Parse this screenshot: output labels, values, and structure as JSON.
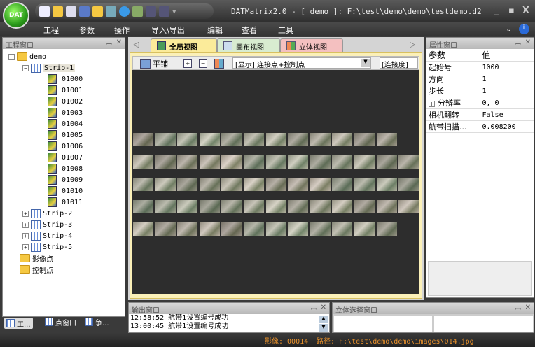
{
  "app": {
    "logo": "DAT",
    "title": "DATMatrix2.0 - [ demo ]: F:\\test\\demo\\demo\\testdemo.d2"
  },
  "menu": [
    "工程",
    "参数",
    "操作",
    "导入\\导出",
    "编辑",
    "查看",
    "工具"
  ],
  "project_panel": {
    "title": "工程窗口",
    "root": "demo",
    "strip1": "Strip-1",
    "images": [
      "01000",
      "01001",
      "01002",
      "01003",
      "01004",
      "01005",
      "01006",
      "01007",
      "01008",
      "01009",
      "01010",
      "01011"
    ],
    "strips": [
      "Strip-2",
      "Strip-3",
      "Strip-4",
      "Strip-5"
    ],
    "image_points": "影像点",
    "control_points": "控制点"
  },
  "bottom_tabs": [
    "工...",
    "点窗口",
    "争..."
  ],
  "tabs": [
    "全局视图",
    "画布视图",
    "立体视图"
  ],
  "toolbar": {
    "tile": "平铺",
    "display": "[显示] 连接点+控制点",
    "connectivity": "[连接度]"
  },
  "image_rows": [
    12,
    13,
    13,
    13,
    12
  ],
  "property_panel": {
    "title": "属性窗口",
    "header": [
      "参数",
      "值"
    ],
    "rows": [
      [
        "起始号",
        "1000"
      ],
      [
        "方向",
        "1"
      ],
      [
        "步长",
        "1"
      ],
      [
        "分辨率",
        "0, 0"
      ],
      [
        "相机翻转",
        "False"
      ],
      [
        "航带扫描...",
        "0.008200"
      ]
    ]
  },
  "output_panel": {
    "title": "输出窗口",
    "lines": [
      "12:58:52  航带1设置编号成功",
      "13:00:45  航带1设置编号成功"
    ]
  },
  "stereo_panel": {
    "title": "立体选择窗口"
  },
  "status": {
    "image": "影像: 00014",
    "path": "路径: F:\\test\\demo\\demo\\images\\014.jpg"
  }
}
